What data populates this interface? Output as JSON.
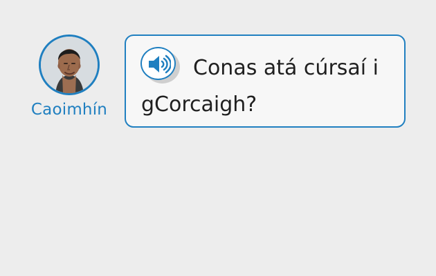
{
  "speaker": {
    "name": "Caoimhín"
  },
  "prompt": {
    "audio_icon": "speaker-volume-icon",
    "text": "Conas atá cúrsaí i gCorcaigh?"
  },
  "colors": {
    "accent": "#1f7fc0",
    "background": "#ededed",
    "bubble": "#f7f7f7",
    "text": "#202020"
  }
}
